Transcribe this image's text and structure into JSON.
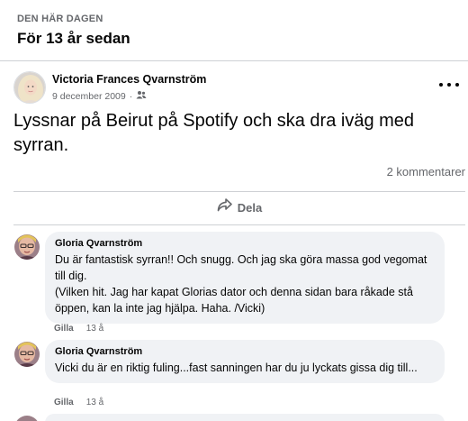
{
  "memory": {
    "kicker": "DEN HÄR DAGEN",
    "years_ago": "För 13 år sedan"
  },
  "post": {
    "author": "Victoria Frances Qvarnström",
    "date": "9 december 2009",
    "separator": "·",
    "audience_icon": "friends-icon",
    "text": "Lyssnar på Beirut på Spotify och ska dra iväg med syrran.",
    "comment_count": "2 kommentarer",
    "share_label": "Dela"
  },
  "comments": [
    {
      "author": "Gloria Qvarnström",
      "text": "Du är fantastisk syrran!! Och snugg. Och jag ska göra massa god vegomat till dig.\n(Vilken hit. Jag har kapat Glorias dator och denna sidan bara råkade stå öppen, kan la inte jag hjälpa. Haha. /Vicki)",
      "like_label": "Gilla",
      "time": "13 å"
    },
    {
      "author": "Gloria Qvarnström",
      "text": "Vicki du är en riktig fuling...fast sanningen har du ju lyckats gissa dig till...",
      "like_label": "Gilla",
      "time": "13 å"
    }
  ],
  "colors": {
    "secondary_text": "#65676b",
    "bubble": "#f0f2f5",
    "divider": "#ced0d4"
  }
}
